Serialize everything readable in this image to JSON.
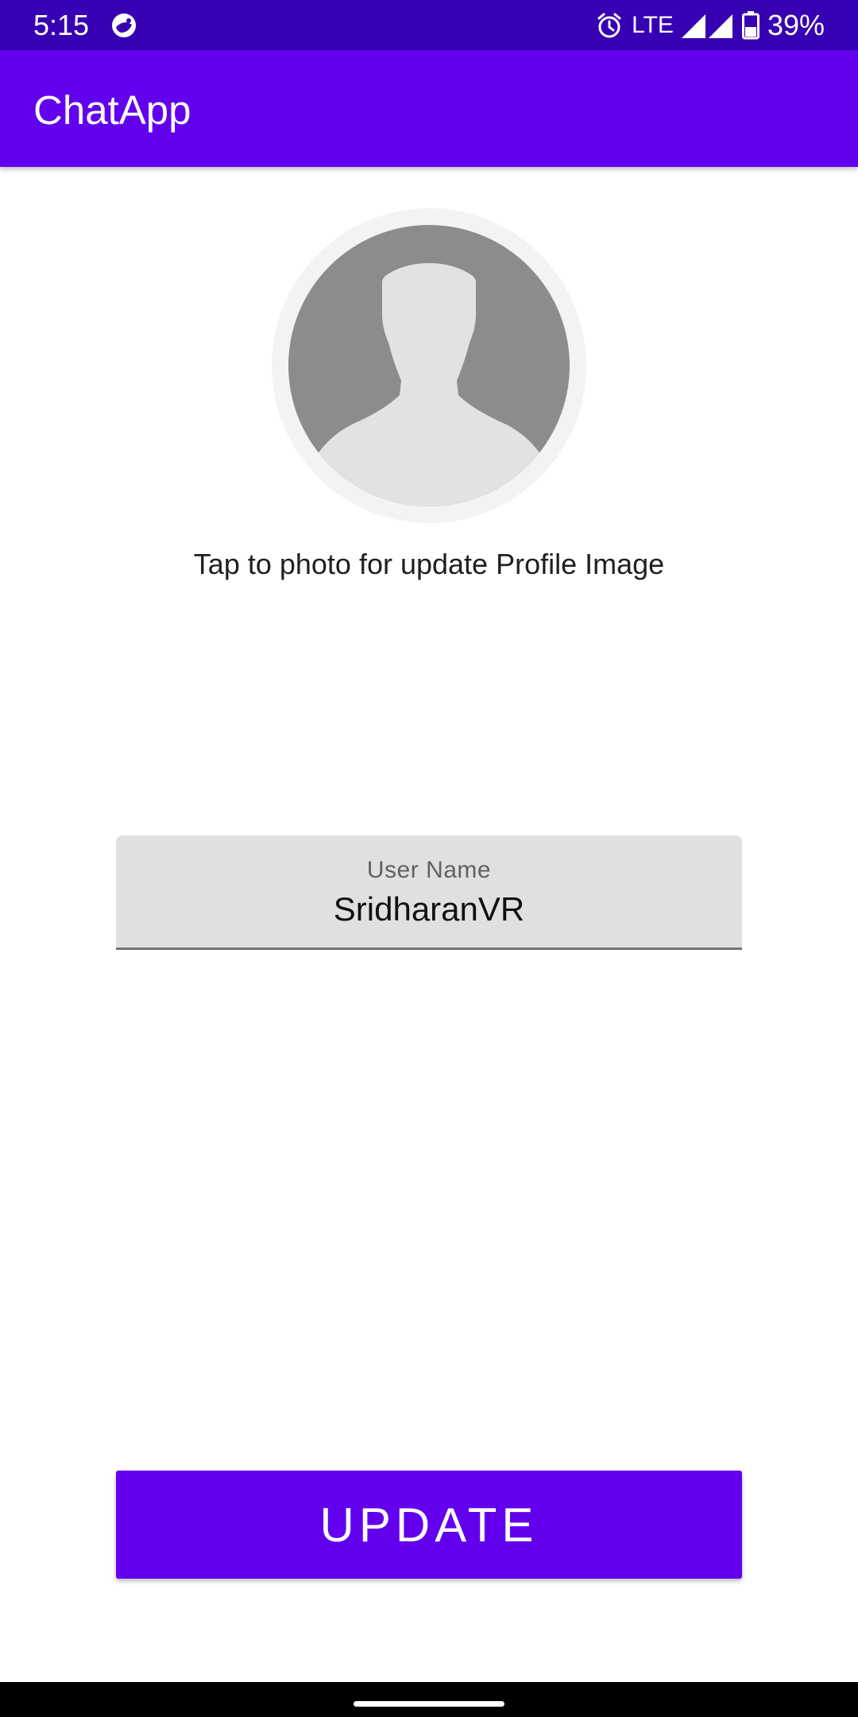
{
  "status_bar": {
    "time": "5:15",
    "notification_icon": "chat-bubble-icon",
    "alarm_icon": "alarm-icon",
    "network": "LTE",
    "signal_icon": "cell-signal-icon",
    "battery_icon": "battery-icon",
    "battery_percent": "39%",
    "background_color": "#3700b3"
  },
  "app_bar": {
    "title": "ChatApp",
    "background_color": "#6200ee"
  },
  "profile": {
    "avatar_icon": "default-person-avatar-icon",
    "hint": "Tap to photo for update Profile Image"
  },
  "username_field": {
    "label": "User Name",
    "value": "SridharanVR"
  },
  "update_button": {
    "label": "UPDATE",
    "color": "#6200ee"
  },
  "nav_bar": {
    "handle": "gesture-handle"
  }
}
